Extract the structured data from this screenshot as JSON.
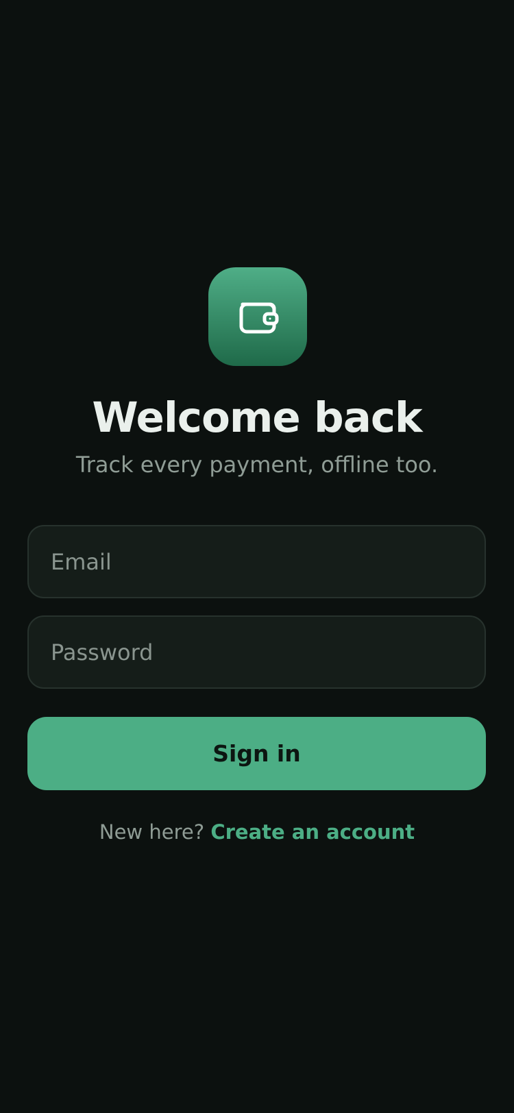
{
  "app": {
    "title": "Welcome back",
    "subtitle": "Track every payment, offline too.",
    "logo_icon": "wallet-icon"
  },
  "form": {
    "email_placeholder": "Email",
    "email_value": "",
    "password_placeholder": "Password",
    "password_value": "",
    "submit_label": "Sign in"
  },
  "footer": {
    "prompt": "New here?",
    "link_label": "Create an account"
  },
  "colors": {
    "background": "#0c110f",
    "accent": "#4cae85",
    "field_background": "#151d19",
    "text_primary": "#eaf0ec",
    "text_muted": "#8f9c95"
  }
}
